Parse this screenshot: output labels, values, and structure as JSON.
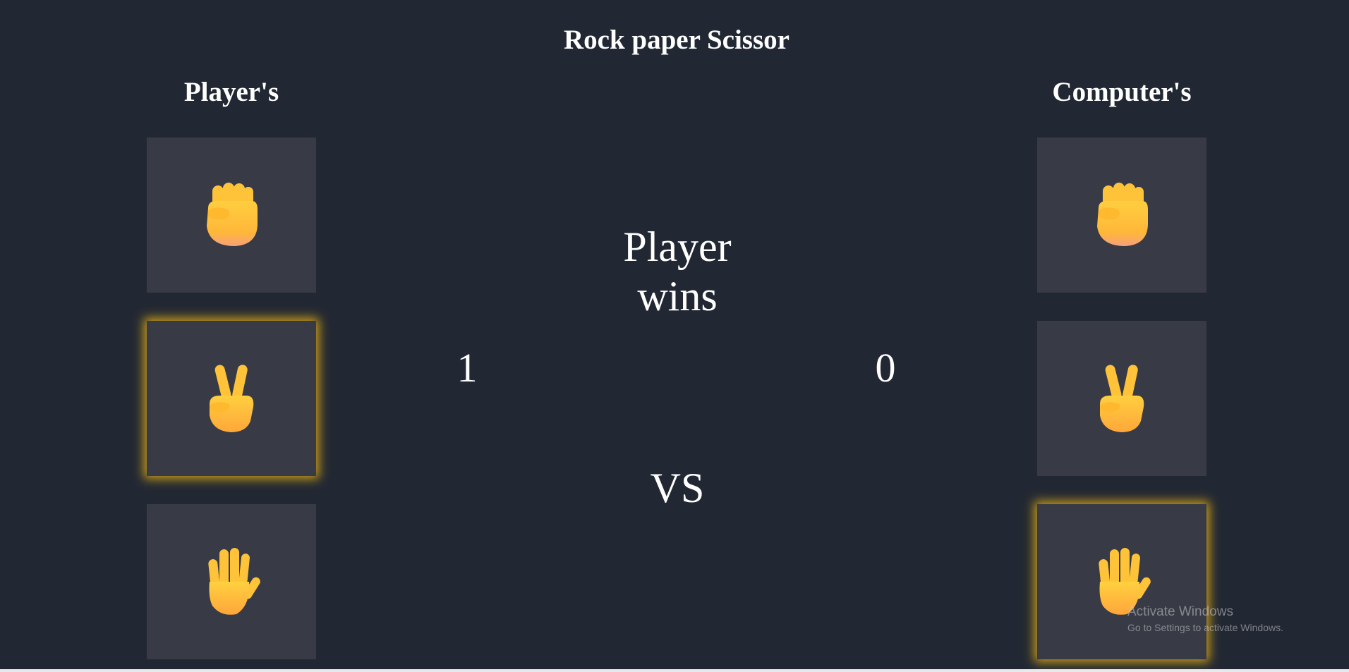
{
  "title": "Rock paper Scissor",
  "player": {
    "label": "Player's",
    "selected": "scissor",
    "score": "1",
    "choices": [
      {
        "id": "rock",
        "icon": "fist-icon"
      },
      {
        "id": "scissor",
        "icon": "victory-hand-icon"
      },
      {
        "id": "paper",
        "icon": "raised-hand-icon"
      }
    ]
  },
  "computer": {
    "label": "Computer's",
    "selected": "paper",
    "score": "0",
    "choices": [
      {
        "id": "rock",
        "icon": "fist-icon"
      },
      {
        "id": "scissor",
        "icon": "victory-hand-icon"
      },
      {
        "id": "paper",
        "icon": "raised-hand-icon"
      }
    ]
  },
  "result": {
    "line1": "Player",
    "line2": "wins"
  },
  "vs": "VS",
  "watermark": {
    "title": "Activate Windows",
    "subtitle": "Go to Settings to activate Windows."
  },
  "colors": {
    "background": "#222833",
    "card": "#383b45",
    "highlight": "#ebb414",
    "hand": "#ffc83d"
  }
}
